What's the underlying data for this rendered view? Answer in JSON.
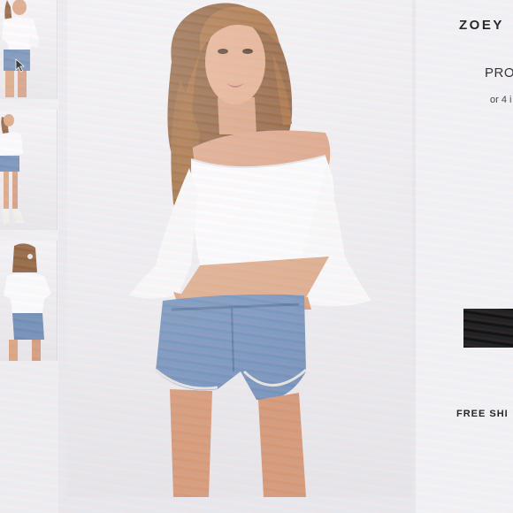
{
  "product": {
    "title": "ZOEY",
    "price": "PRO",
    "installments": "or 4 i"
  },
  "cta": {
    "button_label": ""
  },
  "shipping": {
    "text": "FREE SHI"
  },
  "gallery": {
    "thumbnails": [
      {
        "label": "thumbnail-front-1"
      },
      {
        "label": "thumbnail-full-body"
      },
      {
        "label": "thumbnail-back"
      }
    ]
  },
  "colors": {
    "background": "#e9e8ec",
    "button": "#141414",
    "top": "#fafafa",
    "denim": "#6f8db5"
  }
}
